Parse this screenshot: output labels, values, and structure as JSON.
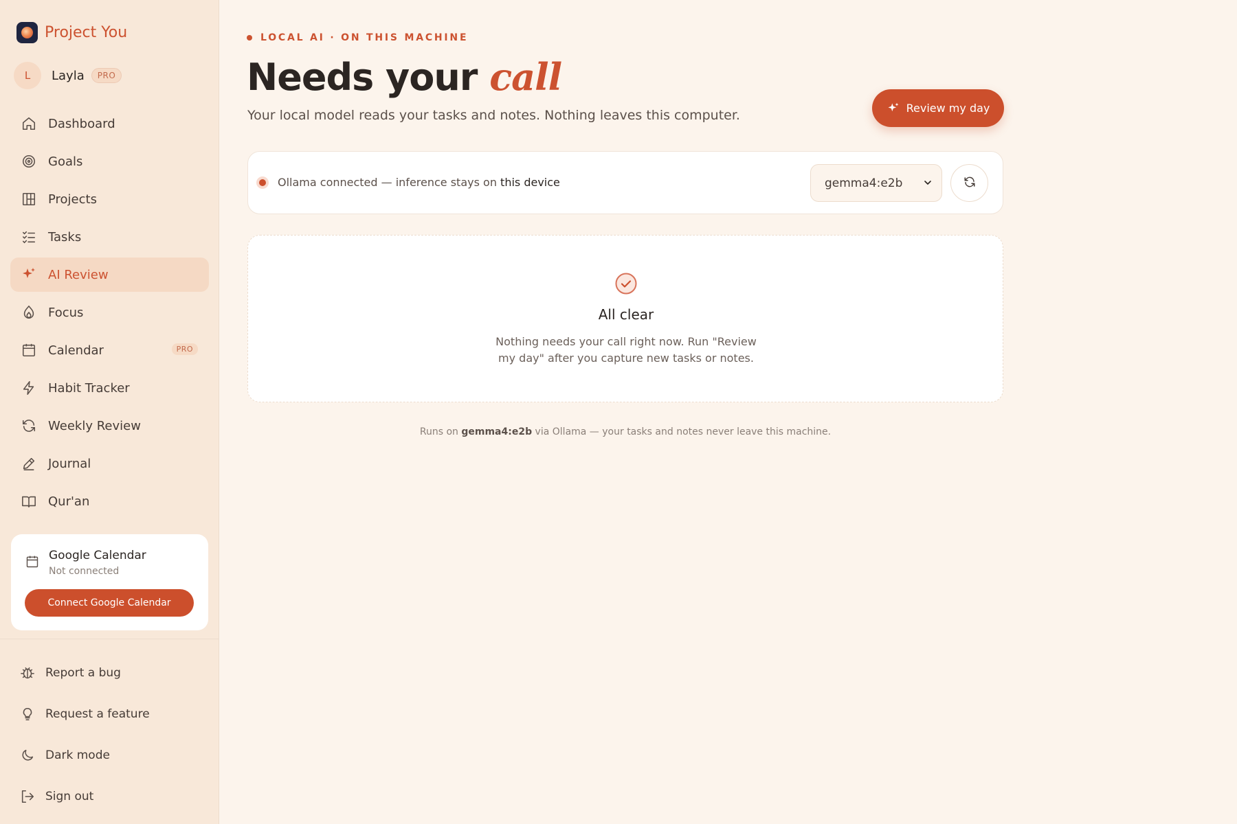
{
  "app": {
    "name": "Project You"
  },
  "user": {
    "initial": "L",
    "name": "Layla",
    "badge": "PRO"
  },
  "sidebar": {
    "items": [
      {
        "label": "Dashboard",
        "icon": "home-icon"
      },
      {
        "label": "Goals",
        "icon": "target-icon"
      },
      {
        "label": "Projects",
        "icon": "grid-icon"
      },
      {
        "label": "Tasks",
        "icon": "checklist-icon"
      },
      {
        "label": "AI Review",
        "icon": "sparkle-icon",
        "active": true
      },
      {
        "label": "Focus",
        "icon": "flame-icon"
      },
      {
        "label": "Calendar",
        "icon": "calendar-icon",
        "badge": "PRO"
      },
      {
        "label": "Habit Tracker",
        "icon": "bolt-icon"
      },
      {
        "label": "Weekly Review",
        "icon": "refresh-icon"
      },
      {
        "label": "Journal",
        "icon": "pencil-icon"
      },
      {
        "label": "Qur'an",
        "icon": "book-icon"
      }
    ],
    "google_calendar": {
      "title": "Google Calendar",
      "status": "Not connected",
      "button": "Connect Google Calendar"
    },
    "footer": [
      {
        "label": "Report a bug",
        "icon": "bug-icon"
      },
      {
        "label": "Request a feature",
        "icon": "lightbulb-icon"
      },
      {
        "label": "Dark mode",
        "icon": "moon-icon"
      },
      {
        "label": "Sign out",
        "icon": "sign-out-icon"
      }
    ]
  },
  "main": {
    "eyebrow": "LOCAL AI · ON THIS MACHINE",
    "title_plain": "Needs your ",
    "title_accent": "call",
    "subtitle": "Your local model reads your tasks and notes. Nothing leaves this computer.",
    "review_button": "Review my day",
    "status": {
      "text_prefix": "Ollama connected — inference stays on ",
      "text_strong": "this device",
      "model": "gemma4:e2b"
    },
    "empty": {
      "title": "All clear",
      "body": "Nothing needs your call right now. Run \"Review my day\" after you capture new tasks or notes."
    },
    "runs_note": {
      "prefix": "Runs on ",
      "model": "gemma4:e2b",
      "suffix": " via Ollama — your tasks and notes never leave this machine."
    }
  },
  "colors": {
    "accent": "#cc4f2c",
    "sidebar_bg": "#f8e8d9",
    "page_bg": "#fcf4ec"
  }
}
